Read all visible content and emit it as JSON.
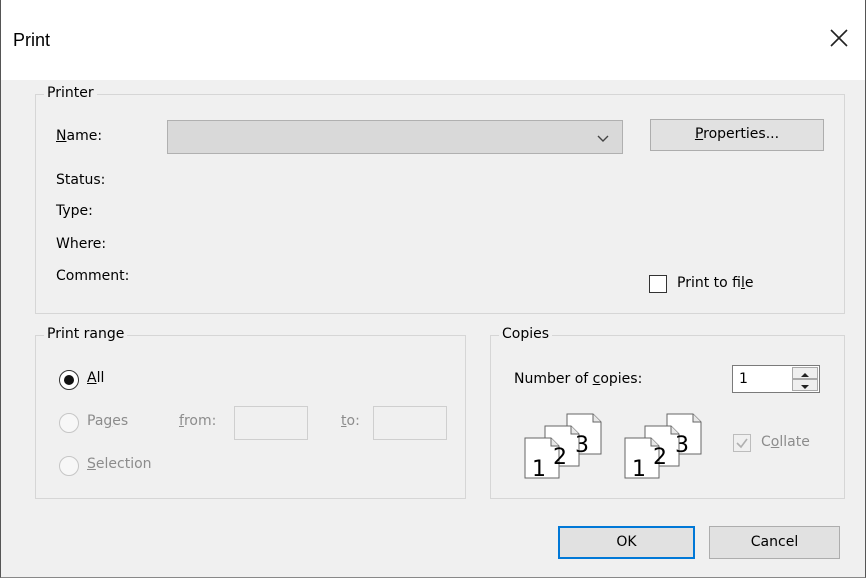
{
  "window": {
    "title": "Print"
  },
  "printer": {
    "legend": "Printer",
    "name_label_pre": "",
    "name_label_u": "N",
    "name_label_post": "ame:",
    "name_value": "",
    "properties_pre": "",
    "properties_u": "P",
    "properties_post": "roperties...",
    "status_label": "Status:",
    "type_label": "Type:",
    "where_label": "Where:",
    "comment_label": "Comment:",
    "print_to_file_pre": "Print to fi",
    "print_to_file_u": "l",
    "print_to_file_post": "e",
    "print_to_file_checked": false
  },
  "print_range": {
    "legend": "Print range",
    "all_u": "A",
    "all_post": "ll",
    "pages_pre": "Pa",
    "pages_u": "g",
    "pages_post": "es",
    "from_u": "f",
    "from_post": "rom:",
    "to_u": "t",
    "to_post": "o:",
    "from_value": "",
    "to_value": "",
    "selection_u": "S",
    "selection_post": "election",
    "selected": "All"
  },
  "copies": {
    "legend": "Copies",
    "number_pre": "Number of ",
    "number_u": "c",
    "number_post": "opies:",
    "value": "1",
    "collate_pre": "C",
    "collate_u": "o",
    "collate_post": "llate",
    "collate_checked": true,
    "page_numbers": [
      "1",
      "2",
      "3"
    ]
  },
  "buttons": {
    "ok": "OK",
    "cancel": "Cancel"
  },
  "colors": {
    "accent": "#0078d7",
    "background": "#f0f0f0"
  },
  "icons": [
    "close-icon",
    "chevron-down-icon",
    "collate-pages-icon",
    "spin-up-icon",
    "spin-down-icon"
  ]
}
